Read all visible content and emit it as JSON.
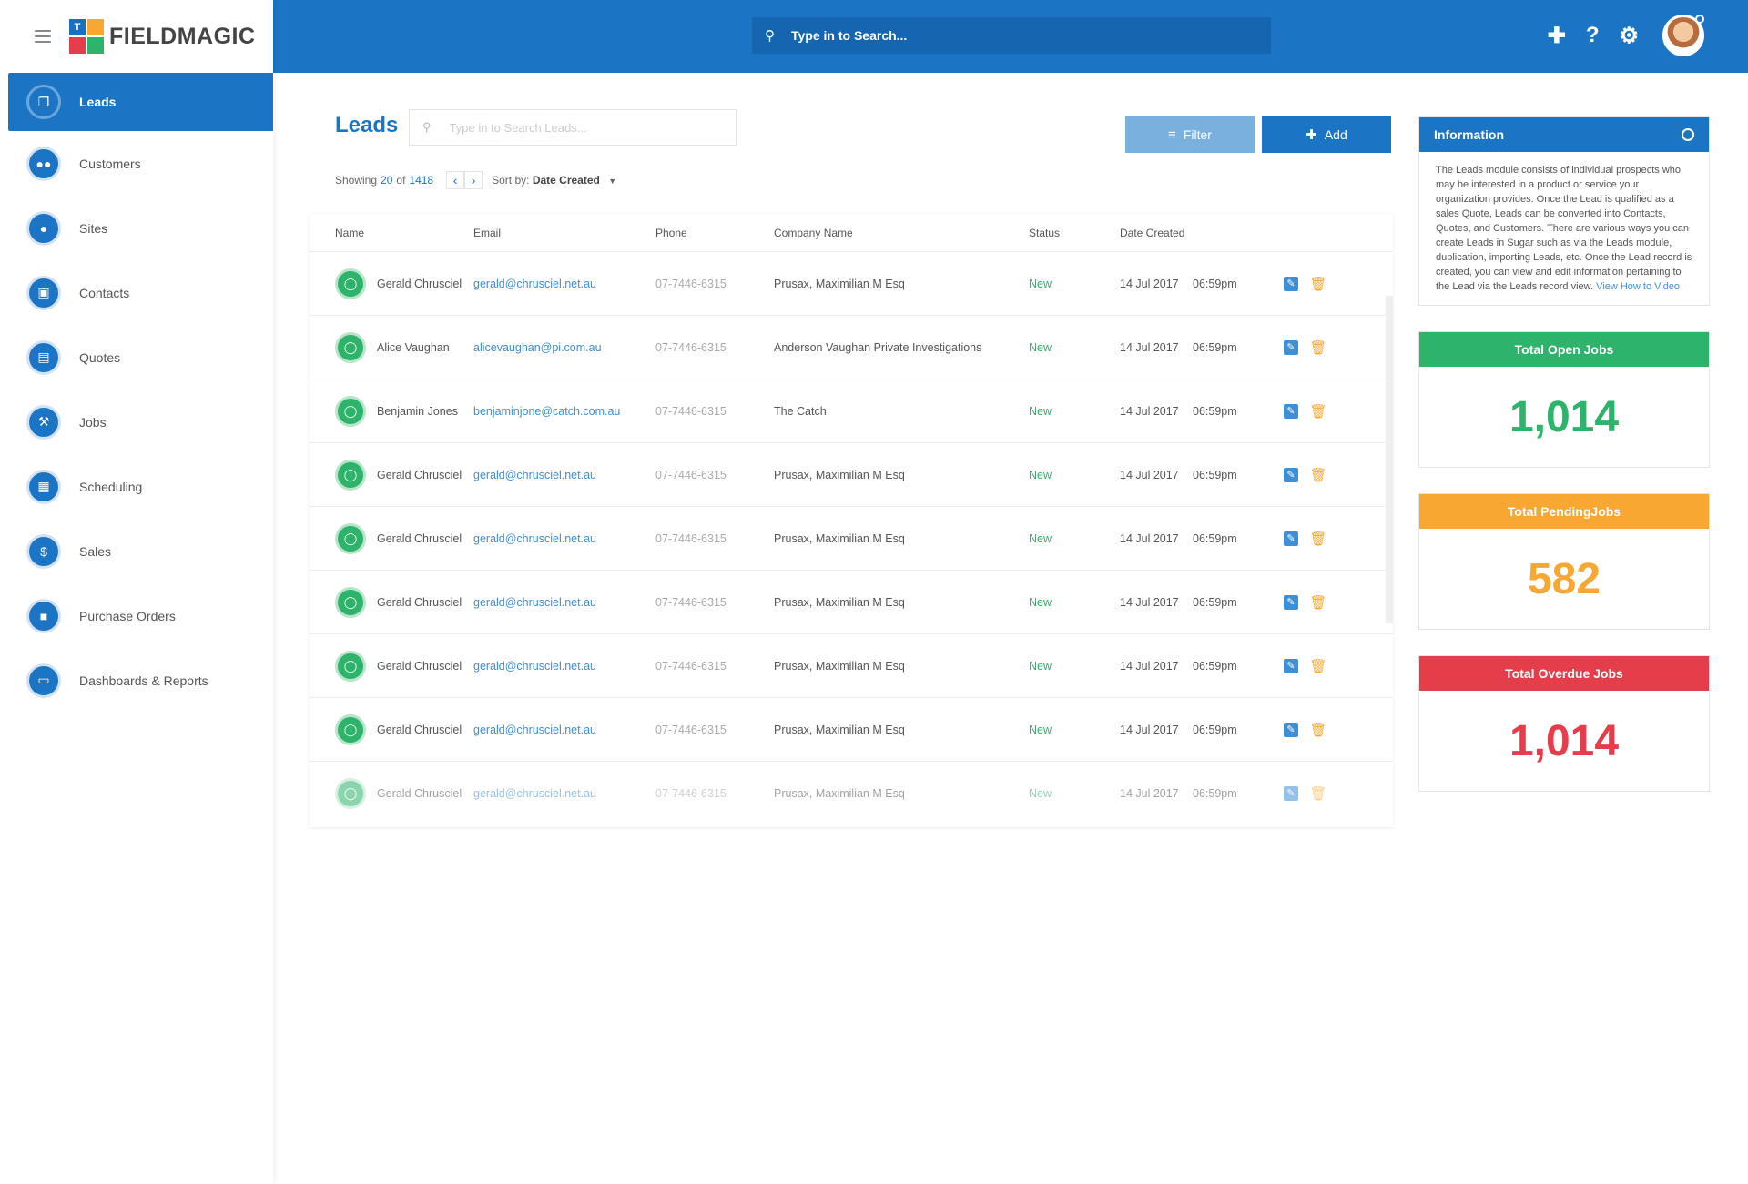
{
  "app": {
    "brand": "FIELDMAGIC",
    "logo_letters": [
      "T",
      "",
      "",
      ""
    ]
  },
  "topbar": {
    "search_placeholder": "Type in to Search...",
    "icons": [
      "plus-icon",
      "help-icon",
      "gear-icon"
    ]
  },
  "sidebar": {
    "items": [
      {
        "label": "Leads",
        "icon": "leads-icon",
        "active": true
      },
      {
        "label": "Customers",
        "icon": "customers-icon"
      },
      {
        "label": "Sites",
        "icon": "location-pin-icon"
      },
      {
        "label": "Contacts",
        "icon": "contacts-icon"
      },
      {
        "label": "Quotes",
        "icon": "document-icon"
      },
      {
        "label": "Jobs",
        "icon": "wrench-icon"
      },
      {
        "label": "Scheduling",
        "icon": "calendar-icon"
      },
      {
        "label": "Sales",
        "icon": "dollar-icon"
      },
      {
        "label": "Purchase Orders",
        "icon": "bag-icon"
      },
      {
        "label": "Dashboards & Reports",
        "icon": "monitor-icon"
      }
    ]
  },
  "page": {
    "title": "Leads",
    "search_placeholder": "Type in to Search Leads...",
    "filter_label": "Filter",
    "add_label": "Add",
    "showing_prefix": "Showing",
    "showing_count": "20",
    "showing_of": "of",
    "showing_total": "1418",
    "sort_prefix": "Sort by:",
    "sort_value": "Date Created"
  },
  "table": {
    "headers": {
      "name": "Name",
      "email": "Email",
      "phone": "Phone",
      "company": "Company Name",
      "status": "Status",
      "date": "Date Created"
    },
    "rows": [
      {
        "name": "Gerald Chrusciel",
        "email": "gerald@chrusciel.net.au",
        "phone": "07-7446-6315",
        "company": "Prusax, Maximilian M Esq",
        "status": "New",
        "date": "14 Jul 2017",
        "time": "06:59pm"
      },
      {
        "name": "Alice Vaughan",
        "email": "alicevaughan@pi.com.au",
        "phone": "07-7446-6315",
        "company": "Anderson Vaughan Private Investigations",
        "status": "New",
        "date": "14 Jul 2017",
        "time": "06:59pm"
      },
      {
        "name": "Benjamin Jones",
        "email": "benjaminjone@catch.com.au",
        "phone": "07-7446-6315",
        "company": "The Catch",
        "status": "New",
        "date": "14 Jul 2017",
        "time": "06:59pm"
      },
      {
        "name": "Gerald Chrusciel",
        "email": "gerald@chrusciel.net.au",
        "phone": "07-7446-6315",
        "company": "Prusax, Maximilian M Esq",
        "status": "New",
        "date": "14 Jul 2017",
        "time": "06:59pm"
      },
      {
        "name": "Gerald Chrusciel",
        "email": "gerald@chrusciel.net.au",
        "phone": "07-7446-6315",
        "company": "Prusax, Maximilian M Esq",
        "status": "New",
        "date": "14 Jul 2017",
        "time": "06:59pm"
      },
      {
        "name": "Gerald Chrusciel",
        "email": "gerald@chrusciel.net.au",
        "phone": "07-7446-6315",
        "company": "Prusax, Maximilian M Esq",
        "status": "New",
        "date": "14 Jul 2017",
        "time": "06:59pm"
      },
      {
        "name": "Gerald Chrusciel",
        "email": "gerald@chrusciel.net.au",
        "phone": "07-7446-6315",
        "company": "Prusax, Maximilian M Esq",
        "status": "New",
        "date": "14 Jul 2017",
        "time": "06:59pm"
      },
      {
        "name": "Gerald Chrusciel",
        "email": "gerald@chrusciel.net.au",
        "phone": "07-7446-6315",
        "company": "Prusax, Maximilian M Esq",
        "status": "New",
        "date": "14 Jul 2017",
        "time": "06:59pm"
      },
      {
        "name": "Gerald Chrusciel",
        "email": "gerald@chrusciel.net.au",
        "phone": "07-7446-6315",
        "company": "Prusax, Maximilian M Esq",
        "status": "New",
        "date": "14 Jul 2017",
        "time": "06:59pm"
      }
    ]
  },
  "info": {
    "title": "Information",
    "body": "The Leads module consists of individual prospects who may be interested in a product or service your organization provides. Once the Lead is qualified as a sales Quote, Leads can be converted into Contacts, Quotes, and Customers. There are various ways you can create Leads in Sugar such as via the Leads module, duplication, importing Leads, etc. Once the Lead record is created, you can view and edit information pertaining to the Lead via the Leads record view.",
    "link": "View How to Video"
  },
  "stats": [
    {
      "title": "Total Open Jobs",
      "value": "1,014",
      "color": "#2db36a"
    },
    {
      "title": "Total PendingJobs",
      "value": "582",
      "color": "#f7a732"
    },
    {
      "title": "Total Overdue Jobs",
      "value": "1,014",
      "color": "#e63d4a"
    }
  ],
  "colors": {
    "primary": "#1b75c4",
    "success": "#2db36a",
    "warning": "#f7a732",
    "danger": "#e63d4a"
  }
}
